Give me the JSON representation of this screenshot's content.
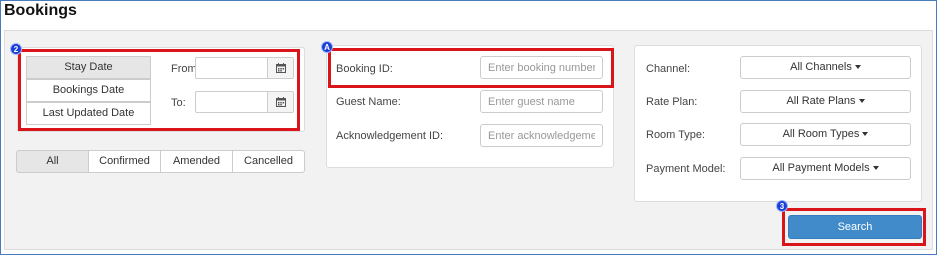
{
  "page": {
    "title": "Bookings"
  },
  "dates": {
    "types": [
      "Stay Date",
      "Bookings Date",
      "Last Updated Date"
    ],
    "from_label": "From:",
    "to_label": "To:"
  },
  "status_filters": [
    "All",
    "Confirmed",
    "Amended",
    "Cancelled"
  ],
  "search_fields": {
    "booking_id": {
      "label": "Booking ID:",
      "placeholder": "Enter booking number"
    },
    "guest_name": {
      "label": "Guest Name:",
      "placeholder": "Enter guest name"
    },
    "ack_id": {
      "label": "Acknowledgement ID:",
      "placeholder": "Enter acknowledgeme…"
    }
  },
  "dropdowns": {
    "channel": {
      "label": "Channel:",
      "value": "All Channels"
    },
    "rate_plan": {
      "label": "Rate Plan:",
      "value": "All Rate Plans"
    },
    "room_type": {
      "label": "Room Type:",
      "value": "All Room Types"
    },
    "payment_model": {
      "label": "Payment Model:",
      "value": "All Payment Models"
    }
  },
  "search_button": "Search",
  "callouts": {
    "dates": "2",
    "booking_id": "A",
    "search": "3"
  },
  "colors": {
    "accent": "#428bca",
    "highlight": "#d9141b",
    "badge": "#1a3fd6"
  }
}
